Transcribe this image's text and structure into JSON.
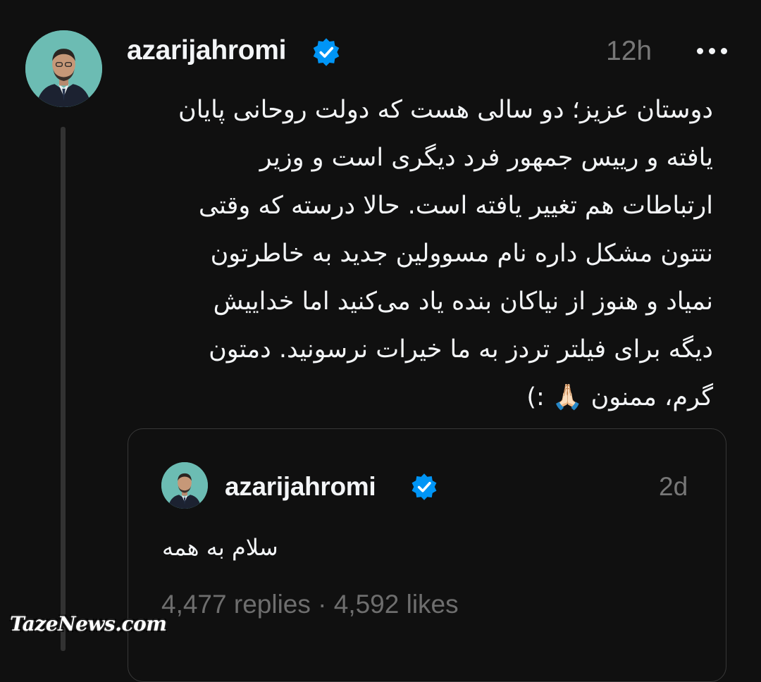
{
  "post": {
    "username": "azarijahromi",
    "timestamp": "12h",
    "more_icon": "more-horizontal-icon",
    "verified_icon": "verified-badge-icon",
    "avatar": "profile-photo",
    "text_lines": [
      "دوستان عزیز؛ دو سالی هست که دولت روحانی پایان",
      "یافته و رییس جمهور فرد دیگری است و وزیر",
      "ارتباطات هم تغییر یافته است. حالا درسته که وقتی",
      "نتتون مشکل داره نام مسوولین جدید به خاطرتون",
      "نمیاد و هنوز از نیاکان بنده یاد می‌کنید اما خداییش",
      "دیگه برای فیلتر تردز به ما خیرات نرسونید. دمتون",
      "گرم، ممنون 🙏🏻 :)"
    ]
  },
  "quoted_post": {
    "username": "azarijahromi",
    "timestamp": "2d",
    "text": "سلام به همه",
    "stats": "4,477 replies · 4,592 likes"
  },
  "watermark": {
    "text": "TazeNews.com"
  },
  "colors": {
    "background": "#101010",
    "text_primary": "#f3f5f7",
    "text_secondary": "#777777",
    "verified_blue": "#0095f6",
    "thread_line": "#323232",
    "card_border": "#383838"
  }
}
